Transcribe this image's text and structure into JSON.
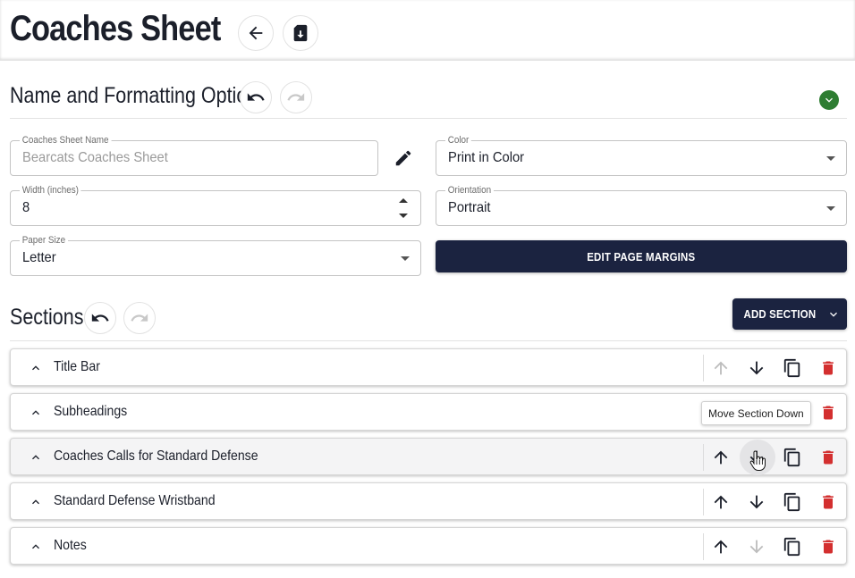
{
  "header": {
    "title": "Coaches Sheet",
    "back_icon": "arrow-left-icon",
    "save_icon": "file-download-icon"
  },
  "formatting": {
    "title": "Name and Formatting Options",
    "undo_icon": "undo-icon",
    "redo_icon": "redo-icon",
    "expand_icon": "chevron-down-icon",
    "expand_color": "#2e7d32",
    "name_field": {
      "label": "Coaches Sheet Name",
      "placeholder": "Bearcats Coaches Sheet"
    },
    "color_field": {
      "label": "Color",
      "value": "Print in Color"
    },
    "width_field": {
      "label": "Width (inches)",
      "value": "8"
    },
    "orientation_field": {
      "label": "Orientation",
      "value": "Portrait"
    },
    "paper_field": {
      "label": "Paper Size",
      "value": "Letter"
    },
    "margins_button": "EDIT PAGE MARGINS"
  },
  "sections": {
    "title": "Sections",
    "add_button": "ADD SECTION",
    "accent": "#1b2340",
    "delete_color": "#d32f2f",
    "items": [
      {
        "label": "Title Bar"
      },
      {
        "label": "Subheadings"
      },
      {
        "label": "Coaches Calls for Standard Defense"
      },
      {
        "label": "Standard Defense Wristband"
      },
      {
        "label": "Notes"
      }
    ]
  },
  "tooltip": {
    "text": "Move Section Down"
  }
}
